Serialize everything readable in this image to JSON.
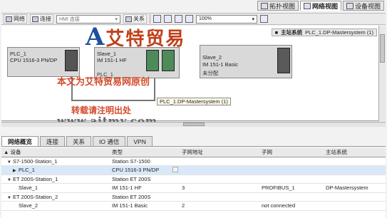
{
  "view_tabs": [
    {
      "label": "拓扑视图",
      "active": false
    },
    {
      "label": "网络视图",
      "active": true
    },
    {
      "label": "设备视图",
      "active": false
    }
  ],
  "toolbar": {
    "network_label": "网络",
    "connect_label": "连接",
    "connect_select": "HMI 连接",
    "relation_label": "关系",
    "zoom": "100%"
  },
  "master_bar": {
    "title": "主站系统",
    "value": "PLC_1.DP-Mastersystem (1)"
  },
  "devices": [
    {
      "name": "PLC_1",
      "type": "CPU 1516-3 PN/DP",
      "state": ""
    },
    {
      "name": "Slave_1",
      "type": "IM 151-1 HF",
      "state": "PLC_1"
    },
    {
      "name": "Slave_2",
      "type": "IM 151-1 Basic",
      "state": "未分配"
    }
  ],
  "link_label": "PLC_1.DP-Mastersystem (1)",
  "watermark": {
    "logo": "艾特贸易",
    "line1": "本文为艾特贸易网原创",
    "line2": "转载请注明出处",
    "url": "www.aitmy.com"
  },
  "bottom_tabs": [
    {
      "label": "网络概览",
      "active": true
    },
    {
      "label": "连接",
      "active": false
    },
    {
      "label": "关系",
      "active": false
    },
    {
      "label": "IO 通信",
      "active": false
    },
    {
      "label": "VPN",
      "active": false
    }
  ],
  "table": {
    "headers": [
      "设备",
      "类型",
      "子网地址",
      "子网",
      "主站系统"
    ],
    "rows": [
      {
        "device": "S7-1500-Station_1",
        "type": "Station S7-1500",
        "addr": "",
        "subnet": "",
        "master": "",
        "indent": 1,
        "expander": "▼",
        "sel": false
      },
      {
        "device": "PLC_1",
        "type": "CPU 1516-3 PN/DP",
        "addr": "",
        "subnet": "",
        "master": "",
        "indent": 2,
        "expander": "▶",
        "sel": true
      },
      {
        "device": "ET 200S-Station_1",
        "type": "Station ET 200S",
        "addr": "",
        "subnet": "",
        "master": "",
        "indent": 1,
        "expander": "▼",
        "sel": false
      },
      {
        "device": "Slave_1",
        "type": "IM 151-1 HF",
        "addr": "3",
        "subnet": "PROFIBUS_1",
        "master": "DP-Mastersystem",
        "indent": 2,
        "expander": "",
        "sel": false
      },
      {
        "device": "ET 200S-Station_2",
        "type": "Station ET 200S",
        "addr": "",
        "subnet": "",
        "master": "",
        "indent": 1,
        "expander": "▼",
        "sel": false
      },
      {
        "device": "Slave_2",
        "type": "IM 151-1 Basic",
        "addr": "2",
        "subnet": "not connected",
        "master": "",
        "indent": 2,
        "expander": "",
        "sel": false
      }
    ]
  }
}
